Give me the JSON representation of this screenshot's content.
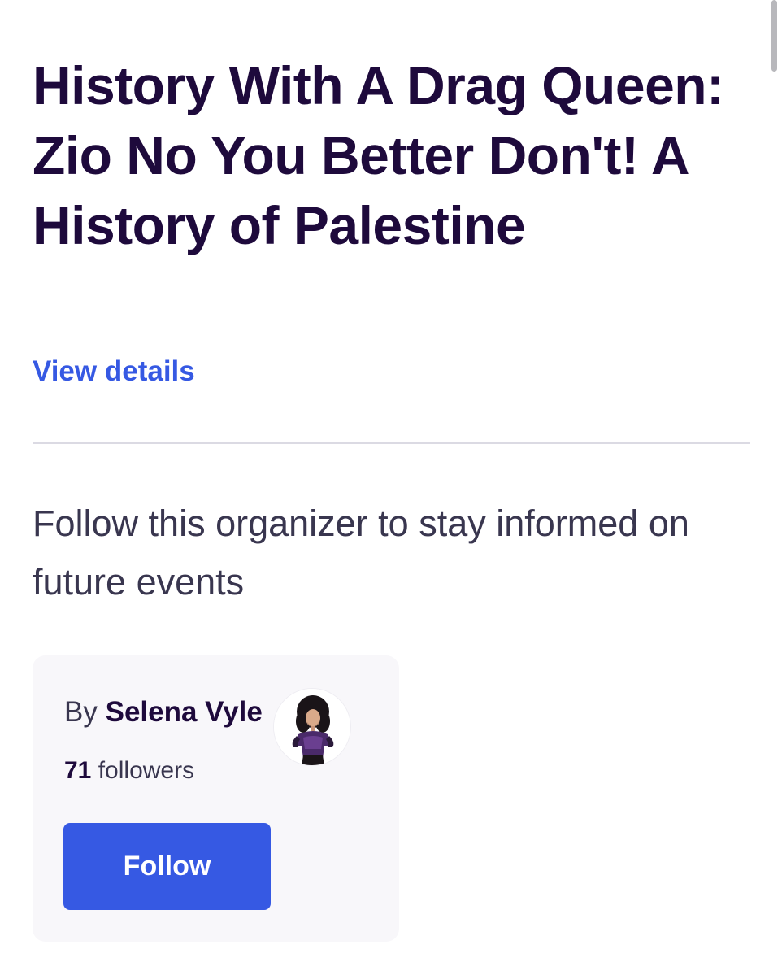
{
  "event": {
    "title": "History With A Drag Queen: Zio No You Better Don't! A History of Palestine",
    "view_details_label": "View details"
  },
  "follow_section": {
    "prompt": "Follow this organizer to stay informed on future events"
  },
  "organizer": {
    "by_label": "By",
    "name": "Selena Vyle",
    "followers_count": "71",
    "followers_label": "followers",
    "follow_button_label": "Follow",
    "avatar_icon": "organizer-avatar"
  },
  "colors": {
    "title": "#1e0a3c",
    "link": "#3659e3",
    "button": "#3659e3",
    "card_bg": "#f8f7fa",
    "divider": "#dbdae3"
  }
}
